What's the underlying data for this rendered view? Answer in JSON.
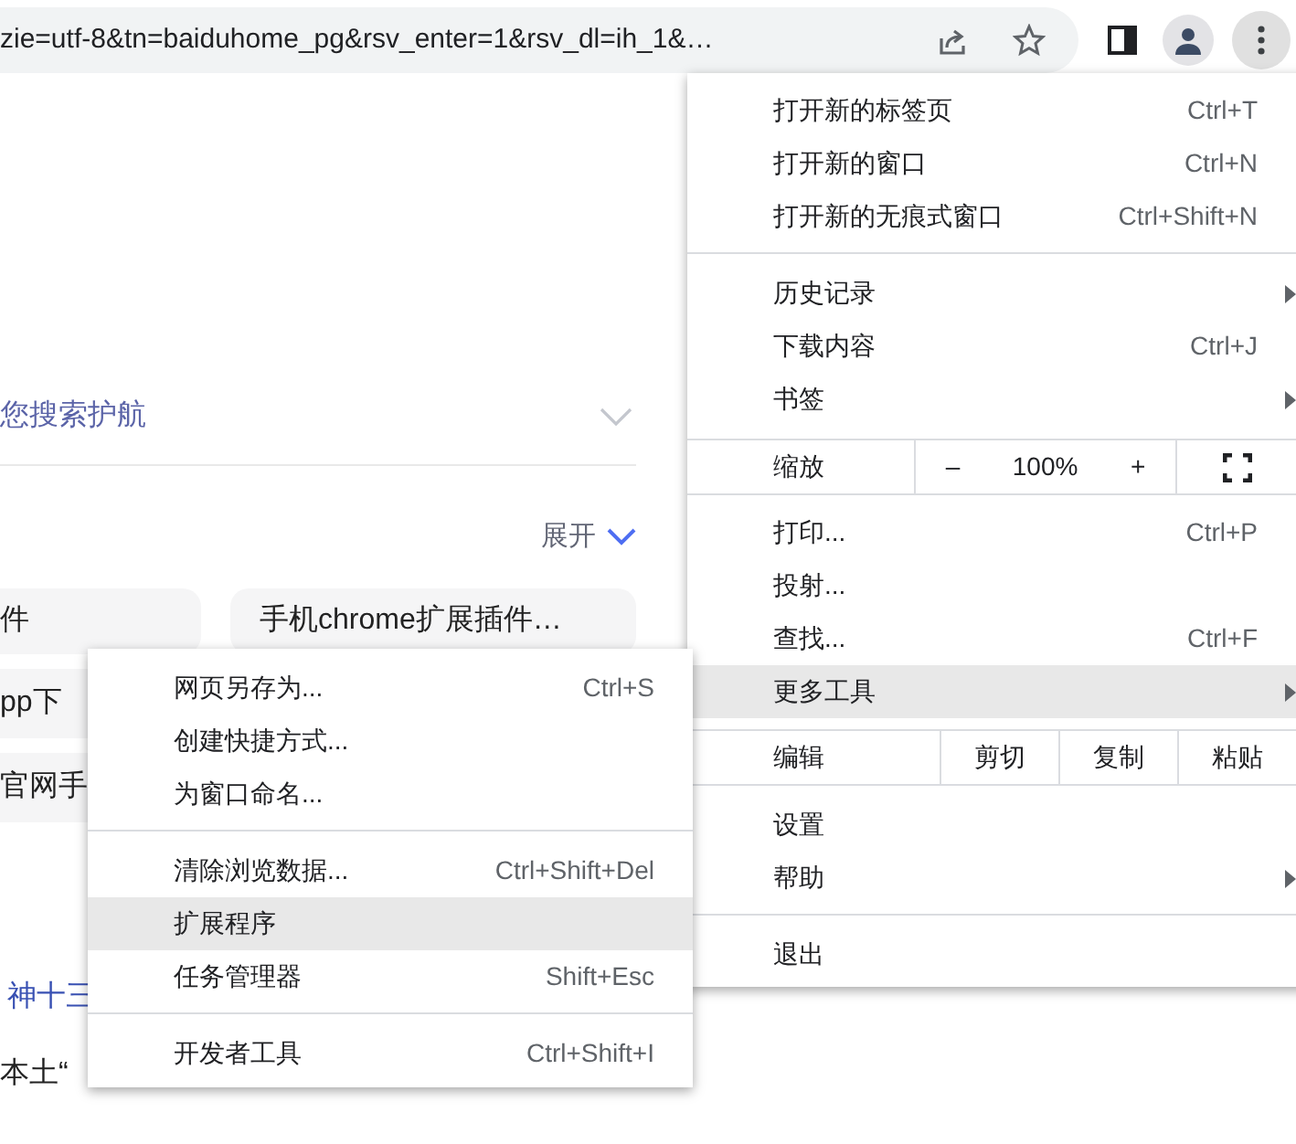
{
  "address_bar": {
    "url": "zie=utf-8&tn=baiduhome_pg&rsv_enter=1&rsv_dl=ih_1&…"
  },
  "page": {
    "nav_text": "您搜索护航",
    "expand": "展开",
    "chips": [
      {
        "label": "件"
      },
      {
        "label": "手机chrome扩展插件…"
      }
    ],
    "chips_left": [
      {
        "label": "pp下"
      },
      {
        "label": "官网手"
      }
    ],
    "news": [
      {
        "label": "神十三",
        "kind": "link"
      },
      {
        "label": "本土“",
        "kind": "hot"
      }
    ]
  },
  "menu": {
    "items": [
      {
        "kind": "item",
        "label": "打开新的标签页",
        "shortcut": "Ctrl+T",
        "submenu": false,
        "selected": false
      },
      {
        "kind": "item",
        "label": "打开新的窗口",
        "shortcut": "Ctrl+N",
        "submenu": false,
        "selected": false
      },
      {
        "kind": "item",
        "label": "打开新的无痕式窗口",
        "shortcut": "Ctrl+Shift+N",
        "submenu": false,
        "selected": false
      },
      {
        "kind": "divider"
      },
      {
        "kind": "item",
        "label": "历史记录",
        "submenu": true,
        "selected": false
      },
      {
        "kind": "item",
        "label": "下载内容",
        "shortcut": "Ctrl+J",
        "submenu": false,
        "selected": false
      },
      {
        "kind": "item",
        "label": "书签",
        "submenu": true,
        "selected": false
      },
      {
        "kind": "zoom",
        "label": "缩放",
        "minus": "–",
        "value": "100%",
        "plus": "+"
      },
      {
        "kind": "item",
        "label": "打印...",
        "shortcut": "Ctrl+P",
        "submenu": false,
        "selected": false
      },
      {
        "kind": "item",
        "label": "投射...",
        "submenu": false,
        "selected": false
      },
      {
        "kind": "item",
        "label": "查找...",
        "shortcut": "Ctrl+F",
        "submenu": false,
        "selected": false
      },
      {
        "kind": "item",
        "label": "更多工具",
        "submenu": true,
        "selected": true
      },
      {
        "kind": "edit",
        "label": "编辑",
        "buttons": [
          "剪切",
          "复制",
          "粘贴"
        ]
      },
      {
        "kind": "item",
        "label": "设置",
        "submenu": false,
        "selected": false
      },
      {
        "kind": "item",
        "label": "帮助",
        "submenu": true,
        "selected": false
      },
      {
        "kind": "divider"
      },
      {
        "kind": "item",
        "label": "退出",
        "submenu": false,
        "selected": false
      }
    ]
  },
  "submenu": {
    "items": [
      {
        "kind": "item",
        "label": "网页另存为...",
        "shortcut": "Ctrl+S",
        "selected": false
      },
      {
        "kind": "item",
        "label": "创建快捷方式...",
        "selected": false
      },
      {
        "kind": "item",
        "label": "为窗口命名...",
        "selected": false
      },
      {
        "kind": "divider"
      },
      {
        "kind": "item",
        "label": "清除浏览数据...",
        "shortcut": "Ctrl+Shift+Del",
        "selected": false
      },
      {
        "kind": "item",
        "label": "扩展程序",
        "selected": true
      },
      {
        "kind": "item",
        "label": "任务管理器",
        "shortcut": "Shift+Esc",
        "selected": false
      },
      {
        "kind": "divider"
      },
      {
        "kind": "item",
        "label": "开发者工具",
        "shortcut": "Ctrl+Shift+I",
        "selected": false
      }
    ]
  }
}
